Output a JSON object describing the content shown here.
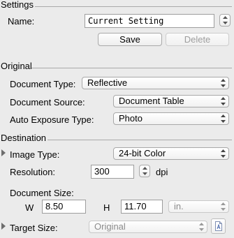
{
  "settings": {
    "title": "Settings",
    "name_label": "Name:",
    "name_value": "Current Setting",
    "save_label": "Save",
    "delete_label": "Delete"
  },
  "original": {
    "title": "Original",
    "doc_type_label": "Document Type:",
    "doc_type_value": "Reflective",
    "doc_source_label": "Document Source:",
    "doc_source_value": "Document Table",
    "auto_exposure_label": "Auto Exposure Type:",
    "auto_exposure_value": "Photo"
  },
  "destination": {
    "title": "Destination",
    "image_type_label": "Image Type:",
    "image_type_value": "24-bit Color",
    "resolution_label": "Resolution:",
    "resolution_value": "300",
    "resolution_unit": "dpi",
    "doc_size_label": "Document Size:",
    "w_label": "W",
    "w_value": "8.50",
    "h_label": "H",
    "h_value": "11.70",
    "unit_value": "in.",
    "target_size_label": "Target Size:",
    "target_size_value": "Original"
  },
  "colors": {
    "background": "#ebebeb",
    "disabled_text": "#9d9d9d"
  }
}
